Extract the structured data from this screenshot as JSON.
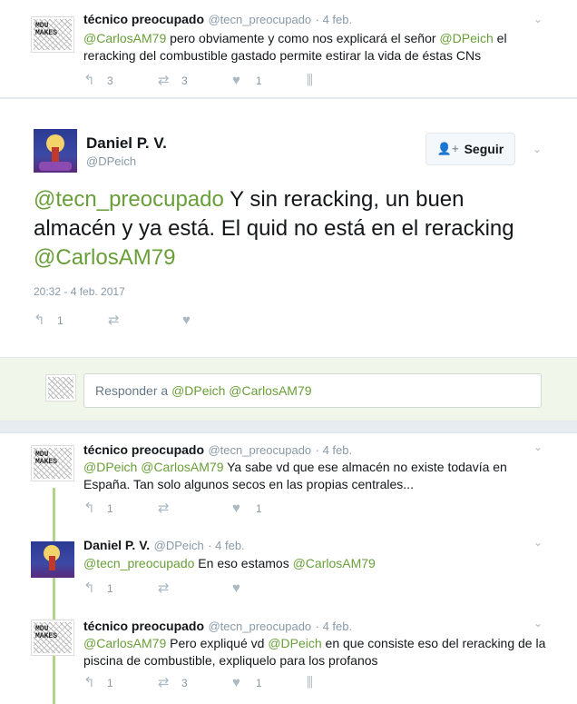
{
  "tweet1": {
    "name": "técnico preocupado",
    "handle": "@tecn_preocupado",
    "time": "4 feb.",
    "text_parts": [
      {
        "t": "@CarlosAM79",
        "m": true
      },
      {
        "t": " pero obviamente y como nos explicará el señor ",
        "m": false
      },
      {
        "t": "@DPeich",
        "m": true
      },
      {
        "t": " el reracking del combustible gastado permite estirar la vida de éstas CNs",
        "m": false
      }
    ],
    "replies": "3",
    "retweets": "3",
    "likes": "1"
  },
  "main": {
    "name": "Daniel P. V.",
    "handle": "@DPeich",
    "follow_label": "Seguir",
    "text_parts": [
      {
        "t": "@tecn_preocupado",
        "m": true
      },
      {
        "t": " Y sin reracking, un buen almacén y ya está. El quid no está en el reracking ",
        "m": false
      },
      {
        "t": "@CarlosAM79",
        "m": true
      }
    ],
    "timestamp": "20:32 - 4 feb. 2017",
    "replies": "1"
  },
  "reply_box": {
    "prefix": "Responder a ",
    "mention1": "@DPeich",
    "mention2": "@CarlosAM79"
  },
  "tweet2": {
    "name": "técnico preocupado",
    "handle": "@tecn_preocupado",
    "time": "4 feb.",
    "text_parts": [
      {
        "t": "@DPeich",
        "m": true
      },
      {
        "t": " ",
        "m": false
      },
      {
        "t": "@CarlosAM79",
        "m": true
      },
      {
        "t": " Ya sabe vd que ese almacén no existe todavía en España. Tan solo algunos secos en las propias centrales...",
        "m": false
      }
    ],
    "replies": "1",
    "retweets": "",
    "likes": "1"
  },
  "tweet3": {
    "name": "Daniel P. V.",
    "handle": "@DPeich",
    "time": "4 feb.",
    "text_parts": [
      {
        "t": "@tecn_preocupado",
        "m": true
      },
      {
        "t": " En eso estamos ",
        "m": false
      },
      {
        "t": "@CarlosAM79",
        "m": true
      }
    ],
    "replies": "1",
    "retweets": "",
    "likes": ""
  },
  "tweet4": {
    "name": "técnico preocupado",
    "handle": "@tecn_preocupado",
    "time": "4 feb.",
    "text_parts": [
      {
        "t": "@CarlosAM79",
        "m": true
      },
      {
        "t": " Pero expliqué vd ",
        "m": false
      },
      {
        "t": "@DPeich",
        "m": true
      },
      {
        "t": " en que consiste eso del reracking de la piscina de combustible, expliquelo para los profanos",
        "m": false
      }
    ],
    "replies": "1",
    "retweets": "3",
    "likes": "1"
  },
  "avatar_text": "MDU\nMAKES",
  "colors": {
    "mention": "#689f38",
    "thread": "#b2d48a",
    "reply_bg": "#f0f6ea"
  },
  "icons": [
    "reply-icon",
    "retweet-icon",
    "like-icon",
    "analytics-icon",
    "chevron-down-icon",
    "follow-icon"
  ]
}
